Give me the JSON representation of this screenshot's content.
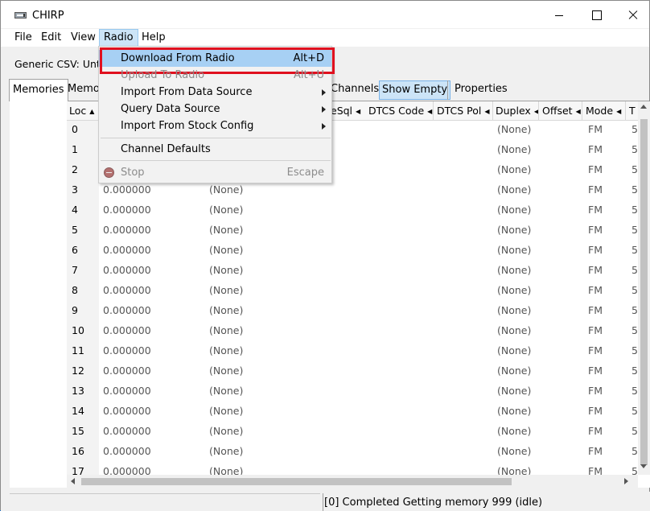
{
  "window": {
    "title": "CHIRP"
  },
  "menubar": [
    "File",
    "Edit",
    "View",
    "Radio",
    "Help"
  ],
  "toolbar": {
    "file_label": "Generic CSV: Unti"
  },
  "tabs": {
    "memories": "Memories",
    "memo": "Memo",
    "channels": "Channels",
    "show_empty": "Show Empty",
    "properties": "Properties"
  },
  "grid": {
    "columns": [
      "Loc",
      "eSql",
      "DTCS Code",
      "DTCS Pol",
      "Duplex",
      "Offset",
      "Mode",
      "T"
    ],
    "rows": [
      {
        "loc": "0",
        "freq": "",
        "name": "",
        "duplex": "(None)",
        "mode": "FM",
        "extra": "5"
      },
      {
        "loc": "1",
        "freq": "",
        "name": "",
        "duplex": "(None)",
        "mode": "FM",
        "extra": "5"
      },
      {
        "loc": "2",
        "freq": "",
        "name": "",
        "duplex": "(None)",
        "mode": "FM",
        "extra": "5"
      },
      {
        "loc": "3",
        "freq": "0.000000",
        "name": "(None)",
        "duplex": "(None)",
        "mode": "FM",
        "extra": "5"
      },
      {
        "loc": "4",
        "freq": "0.000000",
        "name": "(None)",
        "duplex": "(None)",
        "mode": "FM",
        "extra": "5"
      },
      {
        "loc": "5",
        "freq": "0.000000",
        "name": "(None)",
        "duplex": "(None)",
        "mode": "FM",
        "extra": "5"
      },
      {
        "loc": "6",
        "freq": "0.000000",
        "name": "(None)",
        "duplex": "(None)",
        "mode": "FM",
        "extra": "5"
      },
      {
        "loc": "7",
        "freq": "0.000000",
        "name": "(None)",
        "duplex": "(None)",
        "mode": "FM",
        "extra": "5"
      },
      {
        "loc": "8",
        "freq": "0.000000",
        "name": "(None)",
        "duplex": "(None)",
        "mode": "FM",
        "extra": "5"
      },
      {
        "loc": "9",
        "freq": "0.000000",
        "name": "(None)",
        "duplex": "(None)",
        "mode": "FM",
        "extra": "5"
      },
      {
        "loc": "10",
        "freq": "0.000000",
        "name": "(None)",
        "duplex": "(None)",
        "mode": "FM",
        "extra": "5"
      },
      {
        "loc": "11",
        "freq": "0.000000",
        "name": "(None)",
        "duplex": "(None)",
        "mode": "FM",
        "extra": "5"
      },
      {
        "loc": "12",
        "freq": "0.000000",
        "name": "(None)",
        "duplex": "(None)",
        "mode": "FM",
        "extra": "5"
      },
      {
        "loc": "13",
        "freq": "0.000000",
        "name": "(None)",
        "duplex": "(None)",
        "mode": "FM",
        "extra": "5"
      },
      {
        "loc": "14",
        "freq": "0.000000",
        "name": "(None)",
        "duplex": "(None)",
        "mode": "FM",
        "extra": "5"
      },
      {
        "loc": "15",
        "freq": "0.000000",
        "name": "(None)",
        "duplex": "(None)",
        "mode": "FM",
        "extra": "5"
      },
      {
        "loc": "16",
        "freq": "0.000000",
        "name": "(None)",
        "duplex": "(None)",
        "mode": "FM",
        "extra": "5"
      },
      {
        "loc": "17",
        "freq": "0.000000",
        "name": "(None)",
        "duplex": "(None)",
        "mode": "FM",
        "extra": "5"
      }
    ]
  },
  "radio_menu": {
    "download": {
      "label": "Download From Radio",
      "shortcut": "Alt+D"
    },
    "upload": {
      "label": "Upload To Radio",
      "shortcut": "Alt+U"
    },
    "import_data": {
      "label": "Import From Data Source"
    },
    "query_data": {
      "label": "Query Data Source"
    },
    "import_stock": {
      "label": "Import From Stock Config"
    },
    "channel_defaults": {
      "label": "Channel Defaults"
    },
    "stop": {
      "label": "Stop",
      "shortcut": "Escape"
    }
  },
  "status": {
    "text": "[0] Completed Getting memory 999 (idle)"
  },
  "colors": {
    "highlight": "#a7d0f4",
    "annotation_border": "#e0101f",
    "desktop": "#1f6fc4"
  }
}
